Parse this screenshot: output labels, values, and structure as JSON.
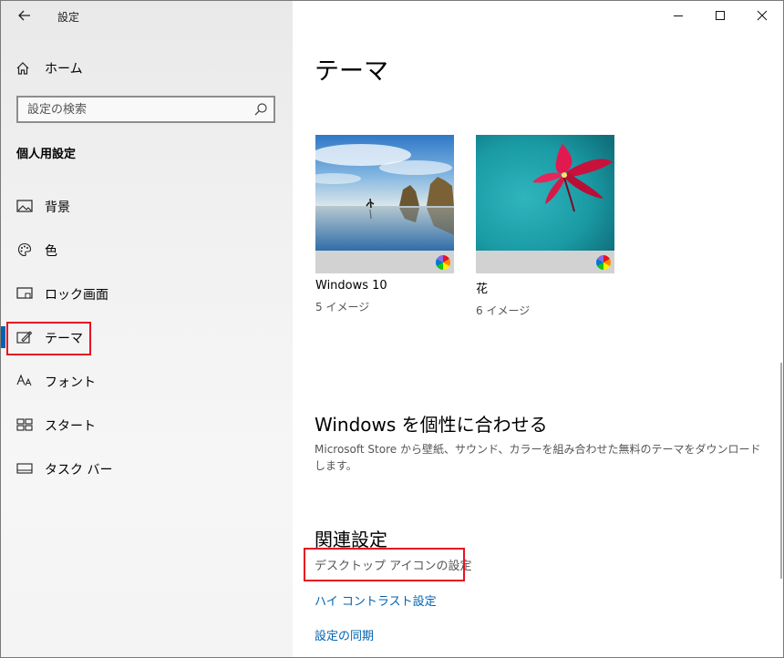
{
  "window": {
    "title": "設定"
  },
  "window_controls": {
    "minimize": "minimize-icon",
    "maximize": "maximize-icon",
    "close": "close-icon"
  },
  "sidebar": {
    "home_label": "ホーム",
    "search": {
      "placeholder": "設定の検索",
      "value": ""
    },
    "section_title": "個人用設定",
    "items": [
      {
        "label": "背景",
        "icon": "picture-icon",
        "selected": false
      },
      {
        "label": "色",
        "icon": "palette-icon",
        "selected": false
      },
      {
        "label": "ロック画面",
        "icon": "lock-screen-icon",
        "selected": false
      },
      {
        "label": "テーマ",
        "icon": "theme-brush-icon",
        "selected": true
      },
      {
        "label": "フォント",
        "icon": "font-icon",
        "selected": false
      },
      {
        "label": "スタート",
        "icon": "start-icon",
        "selected": false
      },
      {
        "label": "タスク バー",
        "icon": "taskbar-icon",
        "selected": false
      }
    ]
  },
  "main": {
    "title": "テーマ",
    "themes": [
      {
        "name": "Windows 10",
        "count": "5 イメージ"
      },
      {
        "name": "花",
        "count": "6 イメージ"
      }
    ],
    "personalize": {
      "title": "Windows を個性に合わせる",
      "description": "Microsoft Store から壁紙、サウンド、カラーを組み合わせた無料のテーマをダウンロードします。"
    },
    "related": {
      "title": "関連設定",
      "links": [
        "デスクトップ アイコンの設定",
        "ハイ コントラスト設定",
        "設定の同期"
      ]
    }
  },
  "colors": {
    "accent": "#0063b1",
    "highlight_box": "#e81123"
  }
}
